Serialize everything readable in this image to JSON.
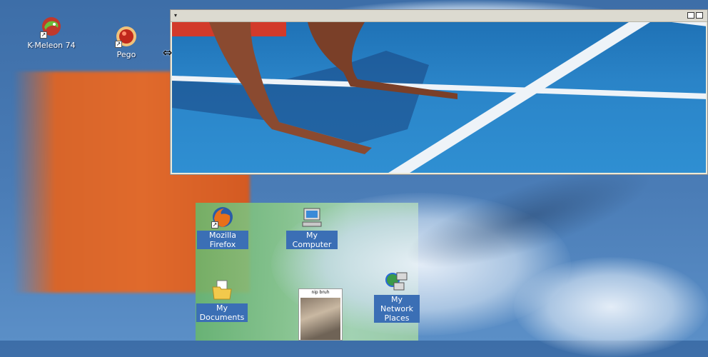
{
  "desktop": {
    "icons": [
      {
        "label": "K-Meleon 74",
        "icon": "k-meleon-icon"
      },
      {
        "label": "Pego",
        "icon": "pego-icon"
      },
      {
        "label": "Mozilla Firefox",
        "icon": "firefox-icon"
      },
      {
        "label": "My Computer",
        "icon": "my-computer-icon"
      },
      {
        "label": "My Documents",
        "icon": "my-documents-icon"
      },
      {
        "label": "My Network Places",
        "icon": "my-network-places-icon"
      }
    ],
    "thumbnail": {
      "caption": "nip bruh"
    }
  },
  "window": {
    "menu_glyph": "▾"
  },
  "colors": {
    "selection": "#3b6fb5",
    "window_chrome": "#ece9d8"
  }
}
